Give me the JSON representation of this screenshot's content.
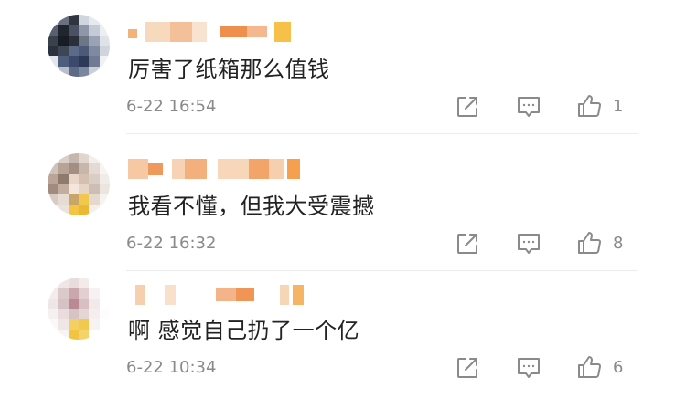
{
  "comments": [
    {
      "text": "厉害了纸箱那么值钱",
      "time": "6-22 16:54",
      "likes": "1"
    },
    {
      "text": "我看不懂，但我大受震撼",
      "time": "6-22 16:32",
      "likes": "8"
    },
    {
      "text": "啊 感觉自己扔了一个亿",
      "time": "6-22 10:34",
      "likes": "6"
    }
  ],
  "icons": {
    "share": "share-icon",
    "reply": "comment-icon",
    "like": "thumbs-up-icon"
  },
  "colors": {
    "text": "#222222",
    "meta": "#8a8a8a",
    "name_blur_orange": "#f0a060"
  }
}
